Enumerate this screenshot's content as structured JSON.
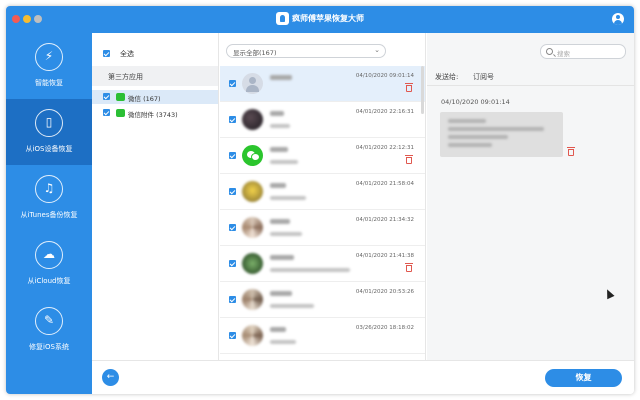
{
  "window": {
    "title": "疯师傅苹果恢复大师"
  },
  "sidebar": {
    "items": [
      {
        "label": "智能恢复",
        "icon": "lightning-icon",
        "glyph": "⚡",
        "active": false
      },
      {
        "label": "从iOS设备恢复",
        "icon": "phone-icon",
        "glyph": "▯",
        "active": true
      },
      {
        "label": "从iTunes备份恢复",
        "icon": "music-note-icon",
        "glyph": "♫",
        "active": false
      },
      {
        "label": "从iCloud恢复",
        "icon": "cloud-icon",
        "glyph": "☁",
        "active": false
      },
      {
        "label": "修复iOS系统",
        "icon": "wrench-icon",
        "glyph": "✎",
        "active": false
      }
    ]
  },
  "categories": {
    "select_all": "全选",
    "section_title": "第三方应用",
    "items": [
      {
        "label": "微信 (167)",
        "selected": true
      },
      {
        "label": "微信附件 (3743)",
        "selected": false
      }
    ]
  },
  "message_list": {
    "filter_value": "显示全部(167)",
    "rows": [
      {
        "date": "04/10/2020 09:01:14",
        "avatar": "default",
        "selected": true,
        "trash": true
      },
      {
        "date": "04/01/2020 22:16:31",
        "avatar": "photo-dark",
        "selected": false,
        "trash": false
      },
      {
        "date": "04/01/2020 22:12:31",
        "avatar": "wechat",
        "selected": false,
        "trash": true
      },
      {
        "date": "04/01/2020 21:58:04",
        "avatar": "photo-yellow",
        "selected": false,
        "trash": false
      },
      {
        "date": "04/01/2020 21:34:32",
        "avatar": "photo-group",
        "selected": false,
        "trash": false
      },
      {
        "date": "04/01/2020 21:41:38",
        "avatar": "photo-green",
        "selected": false,
        "trash": true
      },
      {
        "date": "04/01/2020 20:53:26",
        "avatar": "photo-group",
        "selected": false,
        "trash": false
      },
      {
        "date": "03/26/2020 18:18:02",
        "avatar": "photo-group",
        "selected": false,
        "trash": false
      }
    ]
  },
  "detail": {
    "search_placeholder": "搜索",
    "sender_label": "发送给:",
    "sender_value": "订阅号",
    "timestamp": "04/10/2020 09:01:14"
  },
  "footer": {
    "back_glyph": "←",
    "recover_label": "恢复"
  },
  "colors": {
    "accent": "#2d8de6",
    "accent_dark": "#1d6fc4",
    "danger": "#e0584f"
  }
}
